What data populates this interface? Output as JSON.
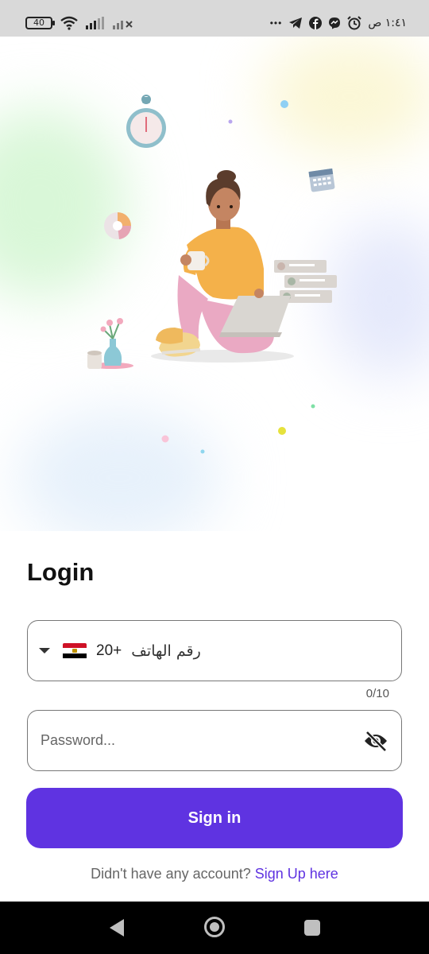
{
  "status_bar": {
    "battery_level": "40",
    "time": "١:٤١ ص",
    "more_indicator": "•••",
    "left_icons": [
      "wifi-icon",
      "signal-icon",
      "signal-muted-icon"
    ],
    "right_icons": [
      "telegram-icon",
      "facebook-icon",
      "messenger-icon",
      "alarm-icon"
    ]
  },
  "hero": {
    "illustration": "person-with-laptop-illustration",
    "accent_colors": [
      "#d9f7d8",
      "#e7f1fb",
      "#fbf7d6",
      "#e5e9fb"
    ]
  },
  "login": {
    "title": "Login",
    "phone": {
      "country_flag": "egypt-flag",
      "dial_code": "20+",
      "placeholder": "رقم الهاتف",
      "value": "",
      "counter": "0/10"
    },
    "password": {
      "placeholder": "Password...",
      "value": "",
      "toggle_icon": "eye-off-icon"
    },
    "sign_in_label": "Sign in",
    "signup_prompt": "Didn't have any account?",
    "signup_link": "Sign Up here"
  },
  "nav_bar": {
    "buttons": [
      "back-icon",
      "home-icon",
      "recents-icon"
    ]
  },
  "colors": {
    "accent": "#5f33e1",
    "status_bar_bg": "#d9d9d9",
    "nav_bar_bg": "#000000"
  }
}
